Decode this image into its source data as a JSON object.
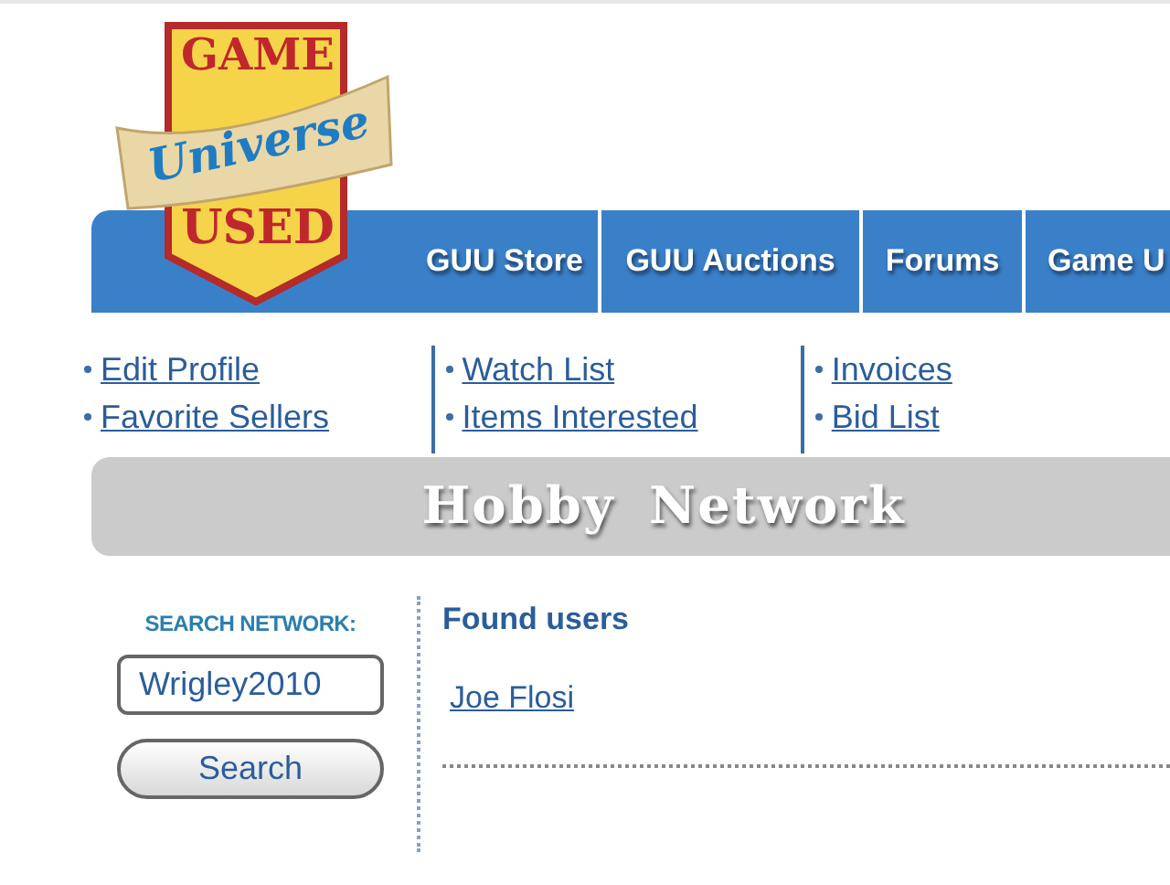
{
  "logo": {
    "top": "GAME",
    "middle": "Universe",
    "bottom": "USED"
  },
  "nav": {
    "tabs": [
      {
        "label": "GUU Store"
      },
      {
        "label": "GUU Auctions"
      },
      {
        "label": "Forums"
      },
      {
        "label": "Game U"
      }
    ]
  },
  "quick_links": [
    {
      "links": [
        "Edit Profile",
        "Favorite Sellers"
      ]
    },
    {
      "links": [
        "Watch List",
        "Items Interested"
      ]
    },
    {
      "links": [
        "Invoices",
        "Bid List"
      ]
    }
  ],
  "banner": {
    "title": "Hobby Network"
  },
  "search": {
    "label": "SEARCH NETWORK:",
    "value": "Wrigley2010",
    "button": "Search"
  },
  "results": {
    "heading": "Found users",
    "users": [
      "Joe Flosi"
    ]
  }
}
